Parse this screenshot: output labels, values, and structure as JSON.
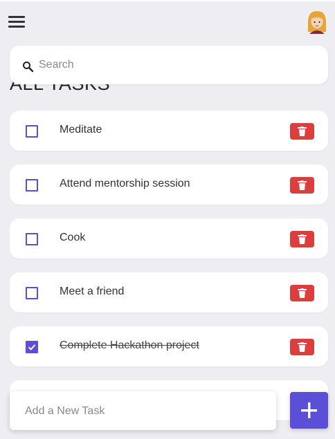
{
  "header": {
    "menu_icon": "hamburger-menu-icon",
    "avatar_icon": "user-avatar-icon"
  },
  "search": {
    "placeholder": "Search",
    "icon": "search-icon"
  },
  "heading": "ALL TASKS",
  "tasks": [
    {
      "label": "Meditate",
      "completed": false
    },
    {
      "label": "Attend mentorship session",
      "completed": false
    },
    {
      "label": "Cook",
      "completed": false
    },
    {
      "label": "Meet a friend",
      "completed": false
    },
    {
      "label": "Complete Hackathon project",
      "completed": true
    }
  ],
  "add_task": {
    "placeholder": "Add a New Task",
    "button_icon": "plus-icon"
  },
  "colors": {
    "accent": "#5b4fd8",
    "delete": "#dc3d3d",
    "background": "#eeeef2"
  }
}
